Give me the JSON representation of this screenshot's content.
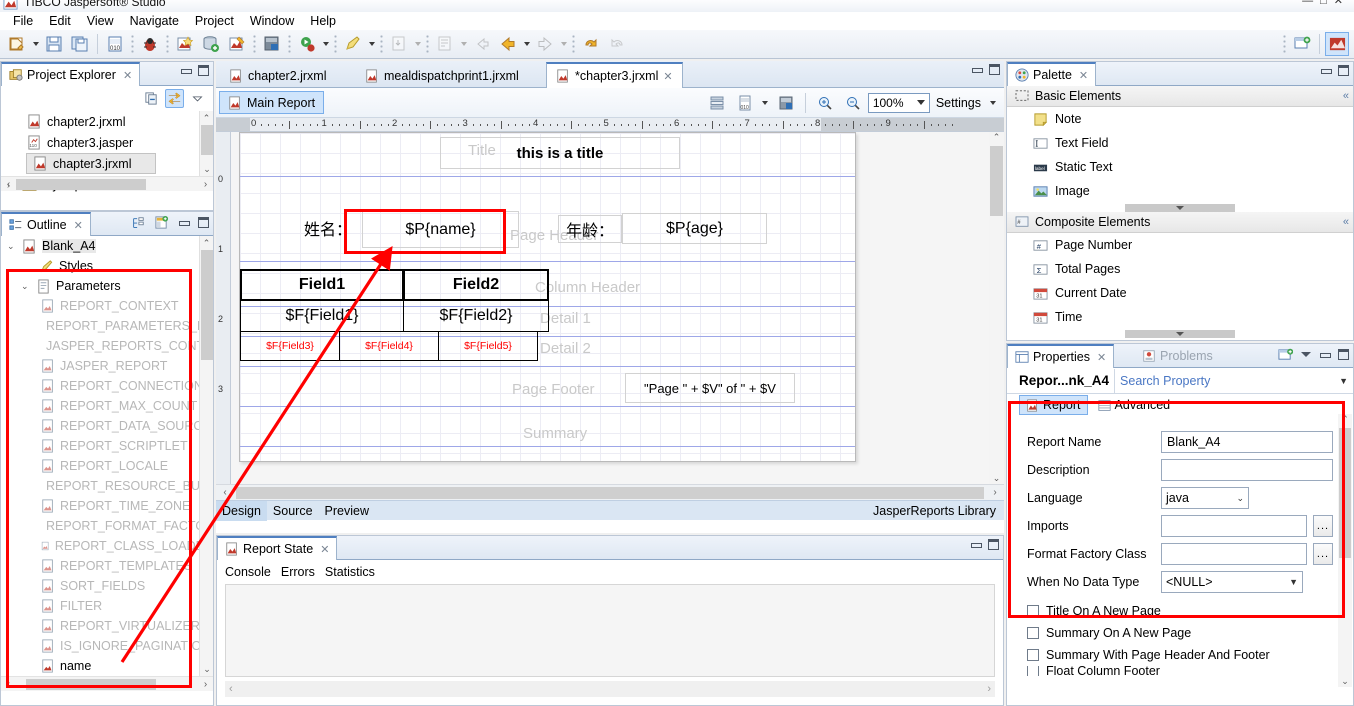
{
  "window": {
    "title": "TIBCO Jaspersoft® Studio",
    "logo_icon": "jaspersoft-logo-icon",
    "minimize_icon": "window-minimize-icon",
    "maximize_icon": "window-maximize-icon",
    "close_icon": "window-close-icon"
  },
  "menu": {
    "items": [
      "File",
      "Edit",
      "View",
      "Navigate",
      "Project",
      "Window",
      "Help"
    ]
  },
  "toolbar": {
    "buttons": [
      {
        "name": "new-icon",
        "dropdown": true
      },
      {
        "name": "save-icon",
        "dropdown": false
      },
      {
        "name": "save-all-icon",
        "dropdown": false
      },
      {
        "name": "new-report-icon",
        "dropdown": false
      },
      {
        "name": "debug-icon",
        "dropdown": false
      },
      {
        "name": "new-jasper-report-icon",
        "dropdown": false
      },
      {
        "name": "new-datasource-icon",
        "dropdown": false
      },
      {
        "name": "compile-report-icon",
        "dropdown": false
      },
      {
        "name": "preview-report-icon",
        "dropdown": false
      },
      {
        "name": "run-icon",
        "dropdown": true
      },
      {
        "name": "external-tools-icon",
        "dropdown": true
      },
      {
        "name": "import-icon",
        "dropdown": true
      },
      {
        "name": "export-icon",
        "dropdown": true
      },
      {
        "name": "back-history-icon",
        "dropdown": false
      },
      {
        "name": "previous-annotation-icon",
        "dropdown": true
      },
      {
        "name": "next-annotation-icon",
        "dropdown": true
      },
      {
        "name": "undo-icon",
        "dropdown": false
      },
      {
        "name": "redo-icon",
        "dropdown": false
      }
    ],
    "right_buttons": [
      {
        "name": "new-window-icon"
      },
      {
        "name": "jasper-perspective-icon"
      }
    ]
  },
  "project_explorer": {
    "tab_label": "Project Explorer",
    "tab_icon": "project-explorer-icon",
    "close_icon": "close-icon",
    "tools": [
      {
        "name": "collapse-all-icon"
      },
      {
        "name": "link-with-editor-icon",
        "selected": true
      },
      {
        "name": "view-menu-icon"
      }
    ],
    "items": [
      {
        "label": "chapter2.jrxml",
        "icon": "jrxml-file-icon",
        "selected": false,
        "indent": 26
      },
      {
        "label": "chapter3.jasper",
        "icon": "jasper-file-icon",
        "selected": false,
        "indent": 26
      },
      {
        "label": "chapter3.jrxml",
        "icon": "jrxml-file-icon",
        "selected": true,
        "indent": 26
      },
      {
        "label": "MyReports",
        "icon": "project-folder-icon",
        "selected": false,
        "indent": 6,
        "twisty": "›"
      }
    ]
  },
  "outline": {
    "tab_label": "Outline",
    "tab_icon": "outline-icon",
    "close_icon": "close-icon",
    "tools": [
      {
        "name": "sort-outline-icon"
      },
      {
        "name": "show-report-elements-icon"
      }
    ],
    "root": {
      "label": "Blank_A4",
      "icon": "report-icon",
      "twisty": "⌄"
    },
    "styles": {
      "label": "Styles",
      "icon": "styles-icon"
    },
    "parameters_group": {
      "label": "Parameters",
      "icon": "parameters-icon",
      "twisty": "⌄"
    },
    "parameters": [
      "REPORT_CONTEXT",
      "REPORT_PARAMETERS_MAP",
      "JASPER_REPORTS_CONTEXT",
      "JASPER_REPORT",
      "REPORT_CONNECTION",
      "REPORT_MAX_COUNT",
      "REPORT_DATA_SOURCE",
      "REPORT_SCRIPTLET",
      "REPORT_LOCALE",
      "REPORT_RESOURCE_BUNDLE",
      "REPORT_TIME_ZONE",
      "REPORT_FORMAT_FACTORY",
      "REPORT_CLASS_LOADER",
      "REPORT_TEMPLATES",
      "SORT_FIELDS",
      "FILTER",
      "REPORT_VIRTUALIZER",
      "IS_IGNORE_PAGINATION",
      "name"
    ],
    "user_parameter": "name"
  },
  "editor": {
    "tabs": [
      {
        "label": "chapter2.jrxml",
        "active": false,
        "icon": "jrxml-file-icon",
        "dirty": false
      },
      {
        "label": "mealdispatchprint1.jrxml",
        "active": false,
        "icon": "jrxml-file-icon",
        "dirty": false
      },
      {
        "label": "*chapter3.jrxml",
        "active": true,
        "icon": "jrxml-file-icon",
        "dirty": true,
        "close_icon": "close-icon"
      }
    ],
    "minimize_icon": "window-minimize-icon",
    "maximize_icon": "window-maximize-icon",
    "subtoolbar": {
      "main_report_label": "Main Report",
      "main_report_icon": "report-icon",
      "buttons": [
        {
          "name": "bands-icon"
        },
        {
          "name": "dataset-icon",
          "dropdown": true
        },
        {
          "name": "compile-icon"
        }
      ],
      "zoom_in_icon": "zoom-in-icon",
      "zoom_out_icon": "zoom-out-icon",
      "zoom_value": "100%",
      "settings_label": "Settings",
      "settings_dropdown_icon": "chevron-down-icon"
    },
    "ruler": {
      "ticks": [
        "0",
        "1",
        "2",
        "3",
        "4",
        "5",
        "6",
        "7",
        "8",
        "9"
      ]
    },
    "canvas": {
      "title_band": {
        "label": "Title",
        "text": "this is a title"
      },
      "page_header_band": {
        "label": "Page Header"
      },
      "column_header_band": {
        "label": "Column Header"
      },
      "detail1_band": {
        "label": "Detail 1"
      },
      "detail2_band": {
        "label": "Detail 2"
      },
      "page_footer_band": {
        "label": "Page Footer"
      },
      "summary_band": {
        "label": "Summary"
      },
      "elements": [
        {
          "name": "title-text",
          "text": "this is a title"
        },
        {
          "name": "name-label",
          "text": "姓名："
        },
        {
          "name": "name-parameter-field",
          "text": "$P{name}",
          "highlighted": true
        },
        {
          "name": "age-label",
          "text": "年龄："
        },
        {
          "name": "age-parameter-field",
          "text": "$P{age}"
        },
        {
          "name": "field1-header",
          "text": "Field1"
        },
        {
          "name": "field2-header",
          "text": "Field2"
        },
        {
          "name": "field1-detail",
          "text": "$F{Field1}"
        },
        {
          "name": "field2-detail",
          "text": "$F{Field2}"
        },
        {
          "name": "field3-detail",
          "text": "$F{Field3}"
        },
        {
          "name": "field4-detail",
          "text": "$F{Field4}"
        },
        {
          "name": "field5-detail",
          "text": "$F{Field5}"
        },
        {
          "name": "page-footer-expression",
          "text": "\"Page \" + $V\" of \" + $V"
        }
      ]
    },
    "bottom_tabs": [
      {
        "label": "Design",
        "active": true
      },
      {
        "label": "Source",
        "active": false
      },
      {
        "label": "Preview",
        "active": false
      }
    ],
    "status_right": "JasperReports Library"
  },
  "report_state": {
    "tab_label": "Report State",
    "tab_icon": "report-icon",
    "close_icon": "close-icon",
    "tabs": [
      "Console",
      "Errors",
      "Statistics"
    ],
    "console_text": "",
    "minimize_icon": "window-minimize-icon",
    "maximize_icon": "window-maximize-icon"
  },
  "palette": {
    "tab_label": "Palette",
    "tab_icon": "palette-icon",
    "close_icon": "close-icon",
    "sections": [
      {
        "label": "Basic Elements",
        "icon": "basic-elements-icon",
        "collapse_icon": "collapse-section-icon",
        "items": [
          {
            "label": "Note",
            "icon": "note-icon"
          },
          {
            "label": "Text Field",
            "icon": "text-field-icon"
          },
          {
            "label": "Static Text",
            "icon": "static-text-icon"
          },
          {
            "label": "Image",
            "icon": "image-icon"
          }
        ]
      },
      {
        "label": "Composite Elements",
        "icon": "composite-elements-icon",
        "collapse_icon": "collapse-section-icon",
        "items": [
          {
            "label": "Page Number",
            "icon": "page-number-icon"
          },
          {
            "label": "Total Pages",
            "icon": "total-pages-icon"
          },
          {
            "label": "Current Date",
            "icon": "current-date-icon"
          },
          {
            "label": "Time",
            "icon": "time-icon"
          }
        ]
      }
    ]
  },
  "properties": {
    "tabs": [
      {
        "label": "Properties",
        "active": true,
        "icon": "properties-icon",
        "close_icon": "close-icon"
      },
      {
        "label": "Problems",
        "active": false,
        "icon": "problems-icon"
      }
    ],
    "header_buttons": [
      {
        "name": "new-view-icon"
      },
      {
        "name": "view-menu-icon"
      },
      {
        "name": "window-minimize-icon"
      },
      {
        "name": "window-maximize-icon"
      }
    ],
    "object_title": "Repor...nk_A4",
    "search_placeholder": "Search Property",
    "search_dropdown_icon": "chevron-down-icon",
    "inner_tabs": [
      {
        "label": "Report",
        "active": true,
        "icon": "report-icon"
      },
      {
        "label": "Advanced",
        "active": false,
        "icon": "advanced-icon"
      }
    ],
    "fields": [
      {
        "label": "Report Name",
        "value": "Blank_A4",
        "type": "text",
        "name": "report-name-field"
      },
      {
        "label": "Description",
        "value": "",
        "type": "text",
        "name": "description-field"
      },
      {
        "label": "Language",
        "value": "java",
        "type": "select",
        "name": "language-select"
      },
      {
        "label": "Imports",
        "value": "",
        "type": "text-browse",
        "name": "imports-field",
        "browse_label": "..."
      },
      {
        "label": "Format Factory Class",
        "value": "",
        "type": "text-browse",
        "name": "format-factory-class-field",
        "browse_label": "..."
      },
      {
        "label": "When No Data Type",
        "value": "<NULL>",
        "type": "select",
        "name": "when-no-data-type-select"
      }
    ],
    "checkboxes": [
      {
        "label": "Title On A New Page",
        "checked": false,
        "name": "title-on-new-page-checkbox"
      },
      {
        "label": "Summary On A New Page",
        "checked": false,
        "name": "summary-on-new-page-checkbox"
      },
      {
        "label": "Summary With Page Header And Footer",
        "checked": false,
        "name": "summary-with-header-footer-checkbox"
      },
      {
        "label": "Float Column Footer",
        "checked": false,
        "name": "float-column-footer-checkbox"
      }
    ]
  },
  "annotations": {
    "color": "#ff0000",
    "boxes": [
      {
        "name": "outline-parameters-highlight"
      },
      {
        "name": "name-field-highlight"
      },
      {
        "name": "properties-report-form-highlight"
      }
    ],
    "arrow": {
      "name": "parameter-to-field-arrow"
    }
  }
}
